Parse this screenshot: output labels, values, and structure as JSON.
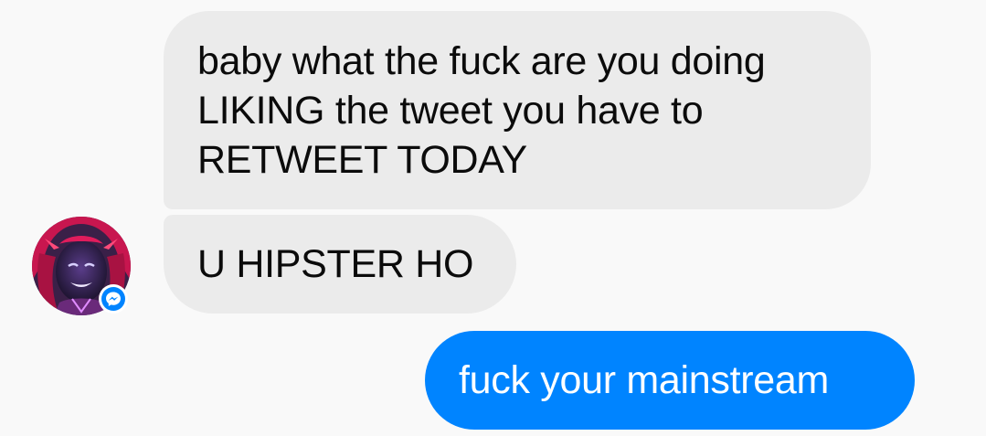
{
  "conversation": {
    "messages": [
      {
        "sender": "contact",
        "text": "baby what the fuck are you doing LIKING the tweet you have to RETWEET TODAY"
      },
      {
        "sender": "contact",
        "text": "U HIPSTER HO"
      },
      {
        "sender": "me",
        "text": "fuck your mainstream"
      }
    ]
  },
  "colors": {
    "background": "#f9f9f9",
    "incoming_bubble": "#ebebeb",
    "outgoing_bubble": "#0084ff",
    "messenger_badge": "#0084ff"
  },
  "icons": {
    "avatar": "contact-avatar",
    "badge": "messenger-icon"
  }
}
